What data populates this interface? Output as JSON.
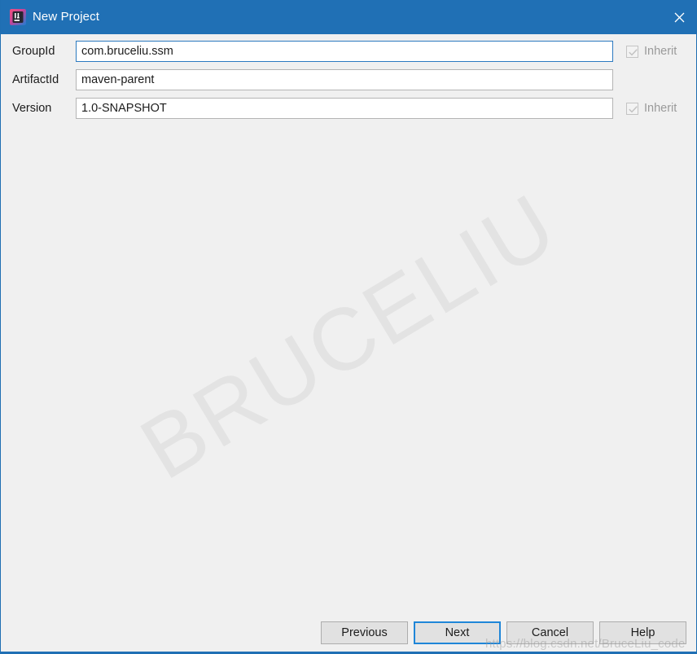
{
  "window": {
    "title": "New Project",
    "app_icon": "intellij-idea-icon",
    "close_icon": "close-icon",
    "titlebar_color": "#2070b5",
    "content_background": "#f0f0f0",
    "border_color": "#1f6fb2"
  },
  "form": {
    "fields": [
      {
        "label": "GroupId",
        "value": "com.bruceliu.ssm",
        "focused": true,
        "inherit": {
          "visible": true,
          "label": "Inherit",
          "checked": true,
          "disabled": true
        }
      },
      {
        "label": "ArtifactId",
        "value": "maven-parent",
        "focused": false,
        "inherit": {
          "visible": false,
          "label": "",
          "checked": false,
          "disabled": true
        }
      },
      {
        "label": "Version",
        "value": "1.0-SNAPSHOT",
        "focused": false,
        "inherit": {
          "visible": true,
          "label": "Inherit",
          "checked": true,
          "disabled": true
        }
      }
    ]
  },
  "watermarks": {
    "diagonal_text": "BRUCELIU",
    "url_text": "https://blog.csdn.net/BruceLiu_code"
  },
  "buttons": {
    "previous": "Previous",
    "next": "Next",
    "cancel": "Cancel",
    "help": "Help",
    "default_button": "Next",
    "default_border_color": "#1f86d8"
  }
}
